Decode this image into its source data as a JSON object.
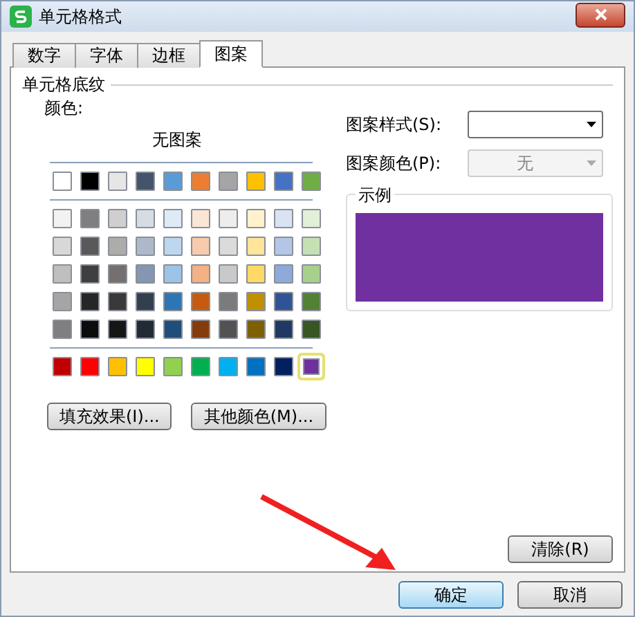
{
  "window": {
    "title": "单元格格式"
  },
  "tabs": [
    {
      "label": "数字",
      "selected": false
    },
    {
      "label": "字体",
      "selected": false
    },
    {
      "label": "边框",
      "selected": false
    },
    {
      "label": "图案",
      "selected": true
    }
  ],
  "shading": {
    "title": "单元格底纹",
    "color_label": "颜色:",
    "no_pattern": "无图案",
    "palette": [
      {
        "swatches": [
          {
            "color": "#ffffff",
            "selected": false
          },
          {
            "color": "#000000",
            "selected": false
          },
          {
            "color": "#e7e6e6",
            "selected": false
          },
          {
            "color": "#44546a",
            "selected": false
          },
          {
            "color": "#5b9bd5",
            "selected": false
          },
          {
            "color": "#ed7d31",
            "selected": false
          },
          {
            "color": "#a5a5a5",
            "selected": false
          },
          {
            "color": "#ffc000",
            "selected": false
          },
          {
            "color": "#4472c4",
            "selected": false
          },
          {
            "color": "#70ad47",
            "selected": false
          }
        ]
      },
      {
        "swatches": [
          {
            "color": "#f2f2f2",
            "selected": false
          },
          {
            "color": "#7f7f7f",
            "selected": false
          },
          {
            "color": "#d0cece",
            "selected": false
          },
          {
            "color": "#d6dce4",
            "selected": false
          },
          {
            "color": "#deebf6",
            "selected": false
          },
          {
            "color": "#fbe5d5",
            "selected": false
          },
          {
            "color": "#ededed",
            "selected": false
          },
          {
            "color": "#fff2cc",
            "selected": false
          },
          {
            "color": "#dae3f3",
            "selected": false
          },
          {
            "color": "#e2efd9",
            "selected": false
          }
        ]
      },
      {
        "swatches": [
          {
            "color": "#d8d8d8",
            "selected": false
          },
          {
            "color": "#595959",
            "selected": false
          },
          {
            "color": "#aeabab",
            "selected": false
          },
          {
            "color": "#adb9ca",
            "selected": false
          },
          {
            "color": "#bdd7ee",
            "selected": false
          },
          {
            "color": "#f7cbac",
            "selected": false
          },
          {
            "color": "#dbdbdb",
            "selected": false
          },
          {
            "color": "#fee599",
            "selected": false
          },
          {
            "color": "#b4c6e7",
            "selected": false
          },
          {
            "color": "#c5e0b3",
            "selected": false
          }
        ]
      },
      {
        "swatches": [
          {
            "color": "#bfbfbf",
            "selected": false
          },
          {
            "color": "#3f3f3f",
            "selected": false
          },
          {
            "color": "#757070",
            "selected": false
          },
          {
            "color": "#8496b0",
            "selected": false
          },
          {
            "color": "#9dc3e6",
            "selected": false
          },
          {
            "color": "#f4b183",
            "selected": false
          },
          {
            "color": "#c9c9c9",
            "selected": false
          },
          {
            "color": "#ffd965",
            "selected": false
          },
          {
            "color": "#8eaadb",
            "selected": false
          },
          {
            "color": "#a8d08d",
            "selected": false
          }
        ]
      },
      {
        "swatches": [
          {
            "color": "#a5a5a5",
            "selected": false
          },
          {
            "color": "#262626",
            "selected": false
          },
          {
            "color": "#3a3838",
            "selected": false
          },
          {
            "color": "#323f4f",
            "selected": false
          },
          {
            "color": "#2e75b5",
            "selected": false
          },
          {
            "color": "#c55a11",
            "selected": false
          },
          {
            "color": "#7b7b7b",
            "selected": false
          },
          {
            "color": "#bf9000",
            "selected": false
          },
          {
            "color": "#2f5496",
            "selected": false
          },
          {
            "color": "#538135",
            "selected": false
          }
        ]
      },
      {
        "swatches": [
          {
            "color": "#7f7f7f",
            "selected": false
          },
          {
            "color": "#0c0c0c",
            "selected": false
          },
          {
            "color": "#171616",
            "selected": false
          },
          {
            "color": "#222a35",
            "selected": false
          },
          {
            "color": "#1e4e79",
            "selected": false
          },
          {
            "color": "#843c0b",
            "selected": false
          },
          {
            "color": "#525252",
            "selected": false
          },
          {
            "color": "#7f6000",
            "selected": false
          },
          {
            "color": "#1f3864",
            "selected": false
          },
          {
            "color": "#375623",
            "selected": false
          }
        ]
      },
      {
        "swatches": [
          {
            "color": "#c00000",
            "selected": false
          },
          {
            "color": "#ff0000",
            "selected": false
          },
          {
            "color": "#ffc000",
            "selected": false
          },
          {
            "color": "#ffff00",
            "selected": false
          },
          {
            "color": "#92d050",
            "selected": false
          },
          {
            "color": "#00b050",
            "selected": false
          },
          {
            "color": "#00b0f0",
            "selected": false
          },
          {
            "color": "#0070c0",
            "selected": false
          },
          {
            "color": "#002060",
            "selected": false
          },
          {
            "color": "#7030a0",
            "selected": true
          }
        ]
      }
    ],
    "buttons": [
      "填充效果(I)...",
      "其他颜色(M)..."
    ]
  },
  "pattern_style": {
    "label": "图案样式(S):"
  },
  "pattern_color": {
    "label": "图案颜色(P):",
    "value": "无",
    "disabled": true
  },
  "sample": {
    "title": "示例"
  },
  "clear_button": "清除(R)",
  "dialog_buttons": [
    {
      "label": "确定",
      "default": true
    },
    {
      "label": "取消",
      "default": false
    }
  ]
}
